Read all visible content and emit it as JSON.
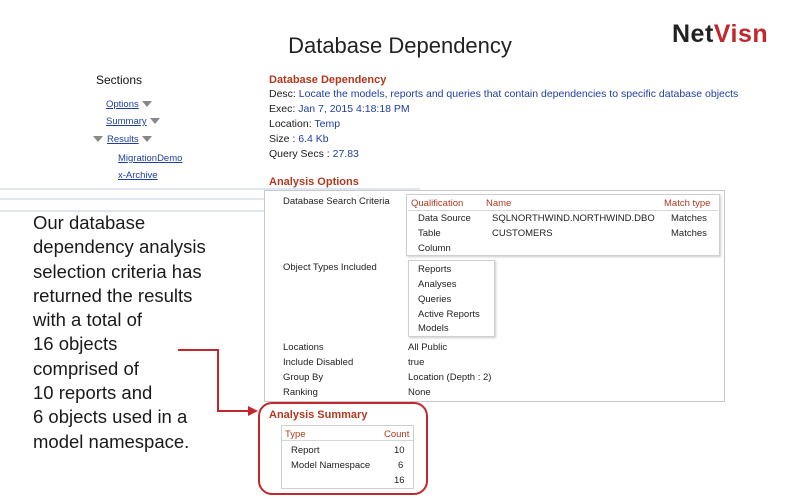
{
  "slide": {
    "title": "Database Dependency",
    "logo_net": "Net",
    "logo_visn": "Visn"
  },
  "sections": {
    "title": "Sections",
    "items": [
      {
        "label": "Options",
        "expandable": true
      },
      {
        "label": "Summary",
        "expandable": true
      },
      {
        "label": "Results",
        "expandable": true,
        "expanded": true
      },
      {
        "label": "MigrationDemo",
        "expandable": false
      },
      {
        "label": "x-Archive",
        "expandable": false
      }
    ]
  },
  "report": {
    "title": "Database Dependency",
    "desc_label": "Desc:",
    "desc_value": "Locate the models, reports and queries that contain dependencies to specific database objects",
    "exec_label": "Exec:",
    "exec_value": "Jan 7, 2015 4:18:18 PM",
    "location_label": "Location:",
    "location_value": "Temp",
    "size_label": "Size :",
    "size_value": "6.4 Kb",
    "query_label": "Query Secs :",
    "query_value": "27.83"
  },
  "analysis_options": {
    "title": "Analysis Options",
    "criteria_label": "Database Search Criteria",
    "criteria_table": {
      "headers": [
        "Qualification",
        "Name",
        "Match type"
      ],
      "rows": [
        [
          "Data Source",
          "SQLNORTHWIND.NORTHWIND.DBO",
          "Matches"
        ],
        [
          "Table",
          "CUSTOMERS",
          "Matches"
        ],
        [
          "Column",
          "",
          ""
        ]
      ]
    },
    "object_types_label": "Object Types Included",
    "object_types": [
      "Reports",
      "Analyses",
      "Queries",
      "Active Reports",
      "Models"
    ],
    "locations_label": "Locations",
    "locations_value": "All Public",
    "include_disabled_label": "Include Disabled",
    "include_disabled_value": "true",
    "group_by_label": "Group By",
    "group_by_value": "Location (Depth : 2)",
    "ranking_label": "Ranking",
    "ranking_value": "None"
  },
  "analysis_summary": {
    "title": "Analysis Summary",
    "headers": [
      "Type",
      "Count"
    ],
    "rows": [
      [
        "Report",
        "10"
      ],
      [
        "Model Namespace",
        "6"
      ]
    ],
    "total": "16"
  },
  "callout": {
    "lines": [
      "Our database",
      "dependency analysis",
      "selection criteria has",
      "returned the results",
      "with a total of",
      "16 objects",
      "comprised of",
      "10 reports and",
      "6 objects used in a",
      "model namespace."
    ]
  },
  "colors": {
    "accent_red": "#c0282d",
    "heading_red": "#b03a1e",
    "link_blue": "#1f3fa0"
  }
}
